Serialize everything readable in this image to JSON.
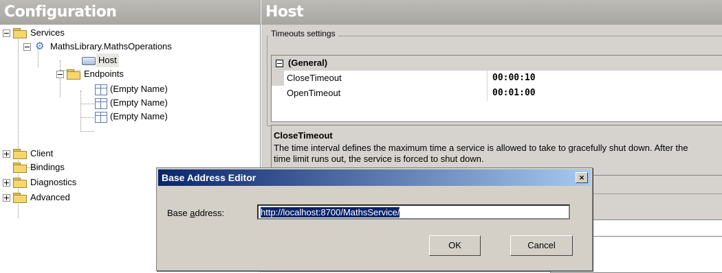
{
  "left_pane": {
    "title": "Configuration",
    "tree": {
      "services": "Services",
      "service_name": "MathsLibrary.MathsOperations",
      "host": "Host",
      "endpoints": "Endpoints",
      "endpoint_items": [
        "(Empty Name)",
        "(Empty Name)",
        "(Empty Name)"
      ],
      "client": "Client",
      "bindings": "Bindings",
      "diagnostics": "Diagnostics",
      "advanced": "Advanced"
    }
  },
  "right_pane": {
    "title": "Host",
    "timeouts_group": "Timeouts settings",
    "grid": {
      "category": "(General)",
      "rows": [
        {
          "name": "CloseTimeout",
          "value": "00:00:10"
        },
        {
          "name": "OpenTimeout",
          "value": "00:01:00"
        }
      ]
    },
    "description": {
      "title": "CloseTimeout",
      "text": "The time interval defines the maximum time a service is allowed to take to gracefully shut down. After the time limit runs out, the service is forced to shut down."
    }
  },
  "dialog": {
    "title": "Base Address Editor",
    "close_glyph": "×",
    "label_prefix": "Base ",
    "label_accel": "a",
    "label_suffix": "ddress:",
    "address_value": "http://localhost:8700/MathsService/",
    "ok_label": "OK",
    "cancel_label": "Cancel"
  },
  "colors": {
    "header_gray": "#a8a6a0",
    "titlebar_start": "#0a246a",
    "titlebar_end": "#a6caf0",
    "folder_yellow": "#f5d76e"
  }
}
